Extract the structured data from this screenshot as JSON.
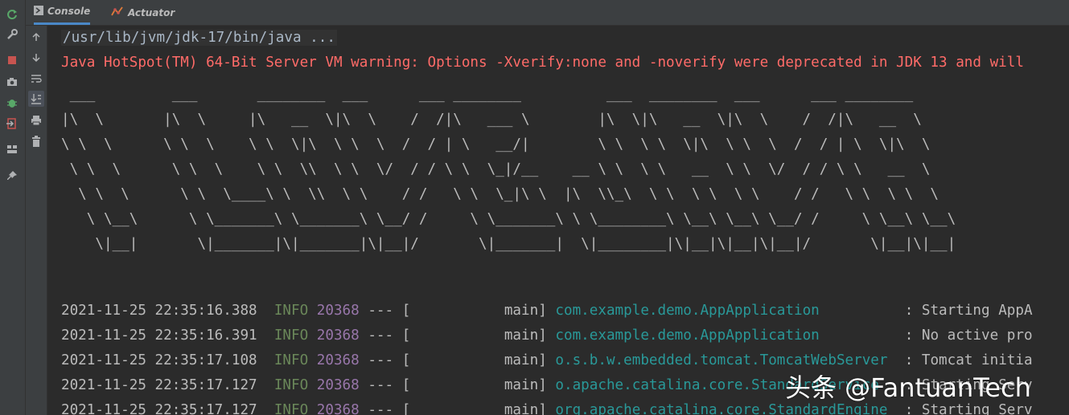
{
  "tabs": [
    {
      "label": "Console",
      "icon": "console-icon"
    },
    {
      "label": "Actuator",
      "icon": "actuator-icon"
    }
  ],
  "left_toolbar": [
    "rerun-icon",
    "settings-wrench-icon",
    "stop-icon",
    "camera-icon",
    "debug-bug-icon",
    "exit-icon",
    "layout-icon",
    "pin-icon"
  ],
  "inner_toolbar": [
    "up-arrow-icon",
    "down-arrow-icon",
    "soft-wrap-icon",
    "scroll-to-end-icon",
    "print-icon",
    "trash-icon"
  ],
  "console": {
    "command": "/usr/lib/jvm/jdk-17/bin/java ...",
    "warning": "Java HotSpot(TM) 64-Bit Server VM warning: Options -Xverify:none and -noverify were deprecated in JDK 13 and will",
    "banner": [
      " ___         ___       ________  ___      ___ ________          ___  ________  ___      ___ ________",
      "|\\  \\       |\\  \\     |\\   __  \\|\\  \\    /  /|\\   ___ \\        |\\  \\|\\   __  \\|\\  \\    /  /|\\   __  \\",
      "\\ \\  \\      \\ \\  \\    \\ \\  \\|\\  \\ \\  \\  /  / | \\   __/|        \\ \\  \\ \\  \\|\\  \\ \\  \\  /  / | \\  \\|\\  \\",
      " \\ \\  \\      \\ \\  \\    \\ \\  \\\\  \\ \\  \\/  / / \\ \\  \\_|/__    __ \\ \\  \\ \\   __  \\ \\  \\/  / / \\ \\   __  \\",
      "  \\ \\  \\      \\ \\  \\____\\ \\  \\\\  \\ \\    / /   \\ \\  \\_|\\ \\  |\\  \\\\_\\  \\ \\  \\ \\  \\ \\    / /   \\ \\  \\ \\  \\",
      "   \\ \\__\\      \\ \\_______\\ \\_______\\ \\__/ /     \\ \\_______\\ \\ \\________\\ \\__\\ \\__\\ \\__/ /     \\ \\__\\ \\__\\",
      "    \\|__|       \\|_______|\\|_______|\\|__|/       \\|_______|  \\|________|\\|__|\\|__|\\|__|/       \\|__|\\|__|"
    ],
    "logs": [
      {
        "ts": "2021-11-25 22:35:16.388",
        "level": "INFO",
        "pid": "20368",
        "sep": "---",
        "thread": "[           main]",
        "cls": "com.example.demo.AppApplication         ",
        "msg": ": Starting AppA"
      },
      {
        "ts": "2021-11-25 22:35:16.391",
        "level": "INFO",
        "pid": "20368",
        "sep": "---",
        "thread": "[           main]",
        "cls": "com.example.demo.AppApplication         ",
        "msg": ": No active pro"
      },
      {
        "ts": "2021-11-25 22:35:17.108",
        "level": "INFO",
        "pid": "20368",
        "sep": "---",
        "thread": "[           main]",
        "cls": "o.s.b.w.embedded.tomcat.TomcatWebServer ",
        "msg": ": Tomcat initia"
      },
      {
        "ts": "2021-11-25 22:35:17.127",
        "level": "INFO",
        "pid": "20368",
        "sep": "---",
        "thread": "[           main]",
        "cls": "o.apache.catalina.core.StandardService  ",
        "msg": ": Starting Serv"
      },
      {
        "ts": "2021-11-25 22:35:17.127",
        "level": "INFO",
        "pid": "20368",
        "sep": "---",
        "thread": "[           main]",
        "cls": "org.apache.catalina.core.StandardEngine ",
        "msg": ": Starting Serv"
      }
    ]
  },
  "watermark": "头条 @FantuanTech",
  "colors": {
    "warning": "#ff6b68",
    "info": "#6a8759",
    "pid": "#9876aa",
    "class": "#299999",
    "accent": "#4a88c7"
  }
}
